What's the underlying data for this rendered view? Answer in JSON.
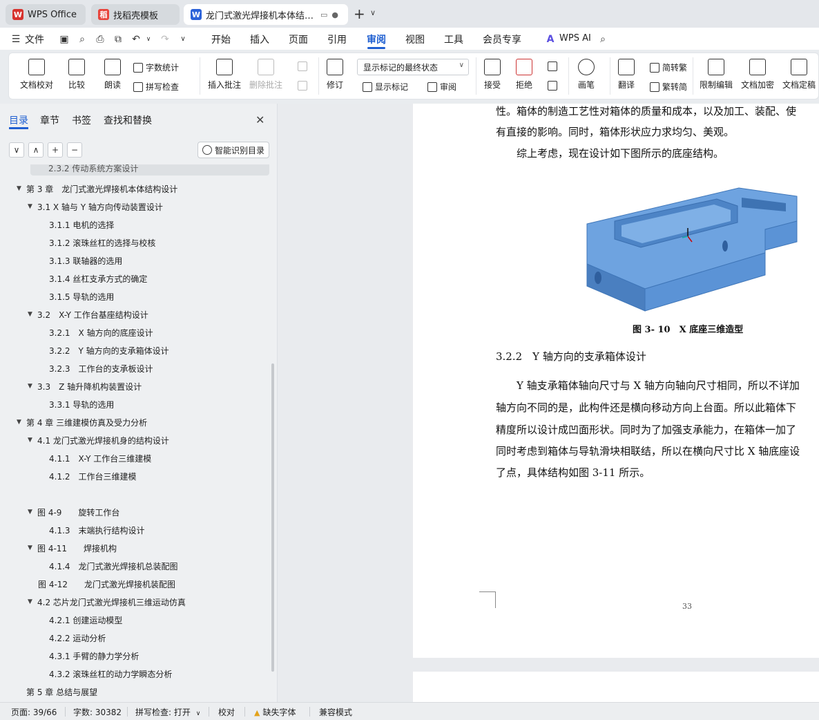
{
  "tabs": [
    {
      "title": "WPS Office",
      "logo": "W",
      "color": "#d6322d"
    },
    {
      "title": "找稻壳模板",
      "logo": "稻",
      "color": "#e8453c"
    },
    {
      "title": "龙门式激光焊接机本体结构与控",
      "logo": "W",
      "color": "#2b62d9"
    }
  ],
  "menu": {
    "file": "文件",
    "items": [
      "开始",
      "插入",
      "页面",
      "引用",
      "审阅",
      "视图",
      "工具",
      "会员专享"
    ],
    "active": "审阅",
    "ai": "WPS AI"
  },
  "ribbon": {
    "doc_check": "文档校对",
    "compare": "比较",
    "read_aloud": "朗读",
    "word_count": "字数统计",
    "spell_check": "拼写检查",
    "insert_comment": "插入批注",
    "delete_comment": "删除批注",
    "revise": "修订",
    "track_state": "显示标记的最终状态",
    "show_markup": "显示标记",
    "review": "审阅",
    "accept": "接受",
    "reject": "拒绝",
    "pen": "画笔",
    "translate": "翻译",
    "to_traditional": "简转繁",
    "to_simplified": "繁转简",
    "restrict_edit": "限制编辑",
    "encrypt": "文档加密",
    "finalize": "文档定稿"
  },
  "nav": {
    "tabs": [
      "目录",
      "章节",
      "书签",
      "查找和替换"
    ],
    "smart_toc": "智能识别目录",
    "partial_top": "2.3.2 传动系统方案设计",
    "toc": [
      {
        "text": "第 3 章　龙门式激光焊接机本体结构设计",
        "level": 1,
        "arrow": true
      },
      {
        "text": "3.1 X 轴与 Y 轴方向传动装置设计",
        "level": 2,
        "arrow": true
      },
      {
        "text": "3.1.1 电机的选择",
        "level": 3,
        "arrow": false
      },
      {
        "text": "3.1.2 滚珠丝杠的选择与校核",
        "level": 3,
        "arrow": false
      },
      {
        "text": "3.1.3 联轴器的选用",
        "level": 3,
        "arrow": false
      },
      {
        "text": "3.1.4 丝杠支承方式的确定",
        "level": 3,
        "arrow": false
      },
      {
        "text": "3.1.5 导轨的选用",
        "level": 3,
        "arrow": false
      },
      {
        "text": "3.2　X-Y 工作台基座结构设计",
        "level": 2,
        "arrow": true
      },
      {
        "text": "3.2.1　X 轴方向的底座设计",
        "level": 3,
        "arrow": false
      },
      {
        "text": "3.2.2　Y 轴方向的支承箱体设计",
        "level": 3,
        "arrow": false
      },
      {
        "text": "3.2.3　工作台的支承板设计",
        "level": 3,
        "arrow": false
      },
      {
        "text": "3.3　Z 轴升降机构装置设计",
        "level": 2,
        "arrow": true
      },
      {
        "text": "3.3.1 导轨的选用",
        "level": 3,
        "arrow": false
      },
      {
        "text": "第 4 章 三维建模仿真及受力分析",
        "level": 1,
        "arrow": true
      },
      {
        "text": "4.1 龙门式激光焊接机身的结构设计",
        "level": 2,
        "arrow": true
      },
      {
        "text": "4.1.1　X-Y 工作台三维建模",
        "level": 3,
        "arrow": false
      },
      {
        "text": "4.1.2　工作台三维建模",
        "level": 3,
        "arrow": false
      },
      {
        "text": "",
        "level": 3,
        "arrow": false
      },
      {
        "text": "图 4-9　　旋转工作台",
        "level": 2,
        "arrow": true
      },
      {
        "text": "4.1.3　末端执行结构设计",
        "level": 3,
        "arrow": false
      },
      {
        "text": "图 4-11　　焊接机构",
        "level": 2,
        "arrow": true
      },
      {
        "text": "4.1.4　龙门式激光焊接机总装配图",
        "level": 3,
        "arrow": false
      },
      {
        "text": "图 4-12　　龙门式激光焊接机装配图",
        "level": 2,
        "arrow": false
      },
      {
        "text": "4.2 芯片龙门式激光焊接机三维运动仿真",
        "level": 2,
        "arrow": true
      },
      {
        "text": "4.2.1 创建运动模型",
        "level": 3,
        "arrow": false
      },
      {
        "text": "4.2.2 运动分析",
        "level": 3,
        "arrow": false
      },
      {
        "text": "4.3.1 手臂的静力学分析",
        "level": 3,
        "arrow": false
      },
      {
        "text": "4.3.2 滚珠丝杠的动力学瞬态分析",
        "level": 3,
        "arrow": false
      },
      {
        "text": "第 5 章 总结与展望",
        "level": 1,
        "arrow": false
      }
    ]
  },
  "doc": {
    "p_top1": "性。箱体的制造工艺性对箱体的质量和成本，以及加工、装配、使",
    "p_top2": "有直接的影响。同时，箱体形状应力求均匀、美观。",
    "p_top3": "　　综上考虑，现在设计如下图所示的底座结构。",
    "figure_caption": "图 3- 10　X 底座三维造型",
    "section_heading": "3.2.2　Y 轴方向的支承箱体设计",
    "p1": "　　Y 轴支承箱体轴向尺寸与 X 轴方向轴向尺寸相同，所以不详加",
    "p2": "轴方向不同的是，此构件还是横向移动方向上台面。所以此箱体下",
    "p3": "精度所以设计成凹面形状。同时为了加强支承能力，在箱体一加了",
    "p4": "同时考虑到箱体与导轨滑块相联结，所以在横向尺寸比 X 轴底座设",
    "p5": "了点，具体结构如图 3-11 所示。",
    "page_number": "33",
    "model_color": "#5b93d6"
  },
  "status": {
    "page": "页面: 39/66",
    "words": "字数: 30382",
    "spell": "拼写检查: 打开",
    "proof": "校对",
    "missing_font": "缺失字体",
    "compat": "兼容模式"
  }
}
